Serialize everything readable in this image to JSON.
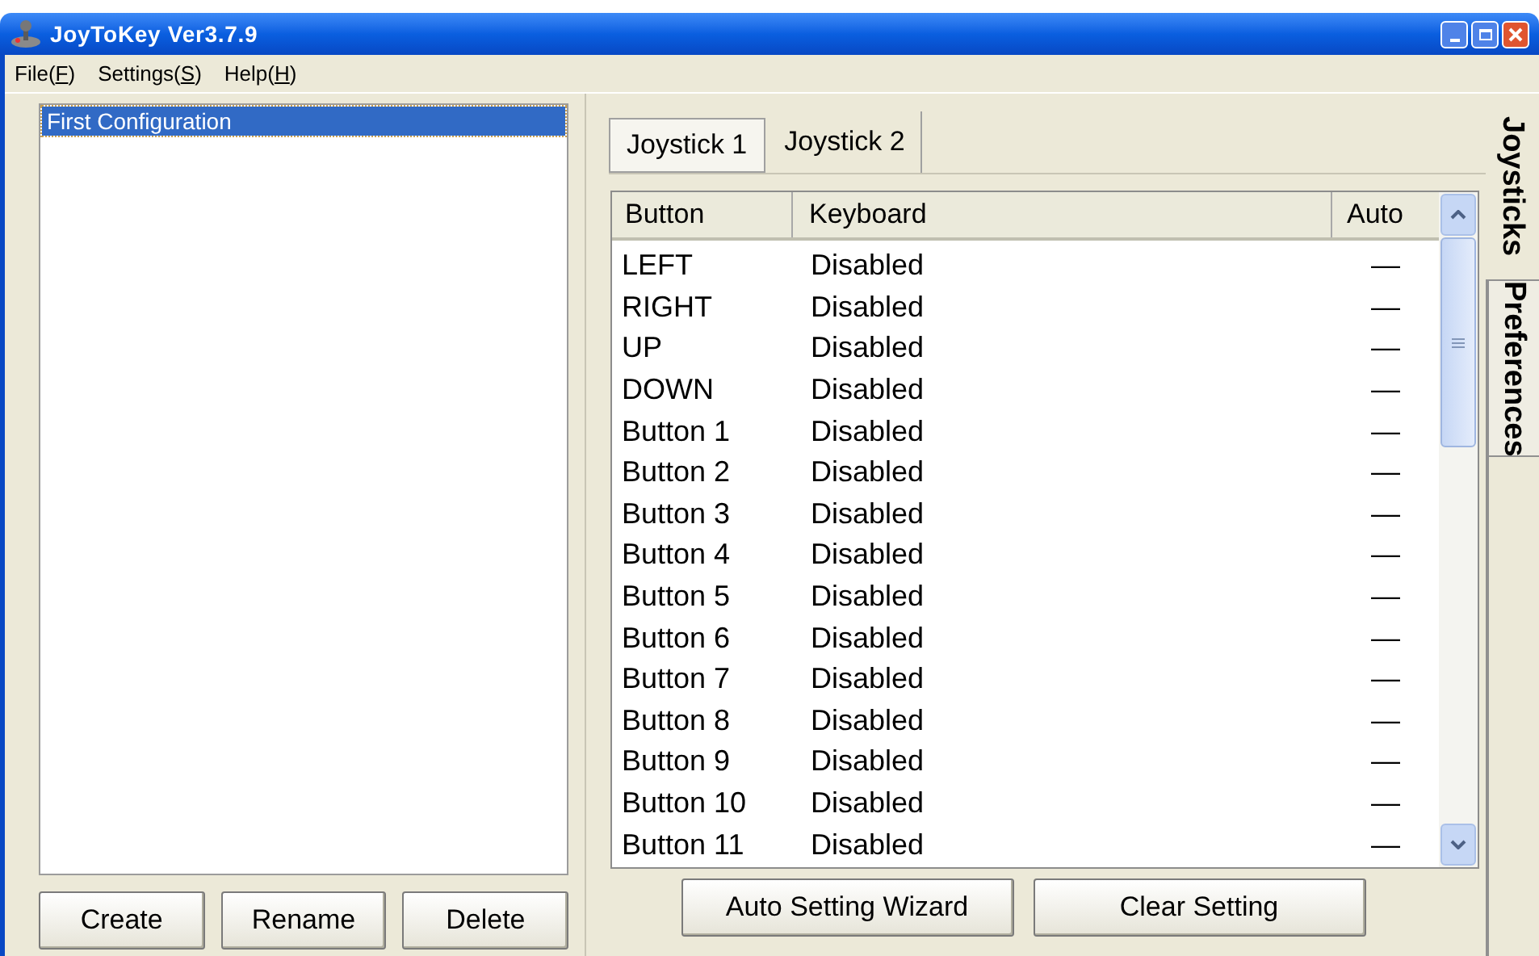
{
  "window": {
    "title": "JoyToKey Ver3.7.9"
  },
  "menu": [
    {
      "prefix": "File(",
      "accel": "F",
      "suffix": ")"
    },
    {
      "prefix": "Settings(",
      "accel": "S",
      "suffix": ")"
    },
    {
      "prefix": "Help(",
      "accel": "H",
      "suffix": ")"
    }
  ],
  "configurations": [
    {
      "label": "First Configuration",
      "selected": true
    }
  ],
  "config_buttons": [
    "Create",
    "Rename",
    "Delete"
  ],
  "joystick_tabs": [
    {
      "label": "Joystick 1",
      "selected": true
    },
    {
      "label": "Joystick 2",
      "selected": false
    }
  ],
  "table": {
    "columns": [
      "Button",
      "Keyboard",
      "Auto"
    ],
    "rows": [
      {
        "button": "LEFT",
        "keyboard": "Disabled",
        "auto": "—"
      },
      {
        "button": "RIGHT",
        "keyboard": "Disabled",
        "auto": "—"
      },
      {
        "button": "UP",
        "keyboard": "Disabled",
        "auto": "—"
      },
      {
        "button": "DOWN",
        "keyboard": "Disabled",
        "auto": "—"
      },
      {
        "button": "Button 1",
        "keyboard": "Disabled",
        "auto": "—"
      },
      {
        "button": "Button 2",
        "keyboard": "Disabled",
        "auto": "—"
      },
      {
        "button": "Button 3",
        "keyboard": "Disabled",
        "auto": "—"
      },
      {
        "button": "Button 4",
        "keyboard": "Disabled",
        "auto": "—"
      },
      {
        "button": "Button 5",
        "keyboard": "Disabled",
        "auto": "—"
      },
      {
        "button": "Button 6",
        "keyboard": "Disabled",
        "auto": "—"
      },
      {
        "button": "Button 7",
        "keyboard": "Disabled",
        "auto": "—"
      },
      {
        "button": "Button 8",
        "keyboard": "Disabled",
        "auto": "—"
      },
      {
        "button": "Button 9",
        "keyboard": "Disabled",
        "auto": "—"
      },
      {
        "button": "Button 10",
        "keyboard": "Disabled",
        "auto": "—"
      },
      {
        "button": "Button 11",
        "keyboard": "Disabled",
        "auto": "—"
      }
    ]
  },
  "action_buttons": [
    "Auto Setting Wizard",
    "Clear Setting"
  ],
  "side_tabs": [
    {
      "label": "Joysticks",
      "selected": true
    },
    {
      "label": "Preferences",
      "selected": false
    }
  ]
}
